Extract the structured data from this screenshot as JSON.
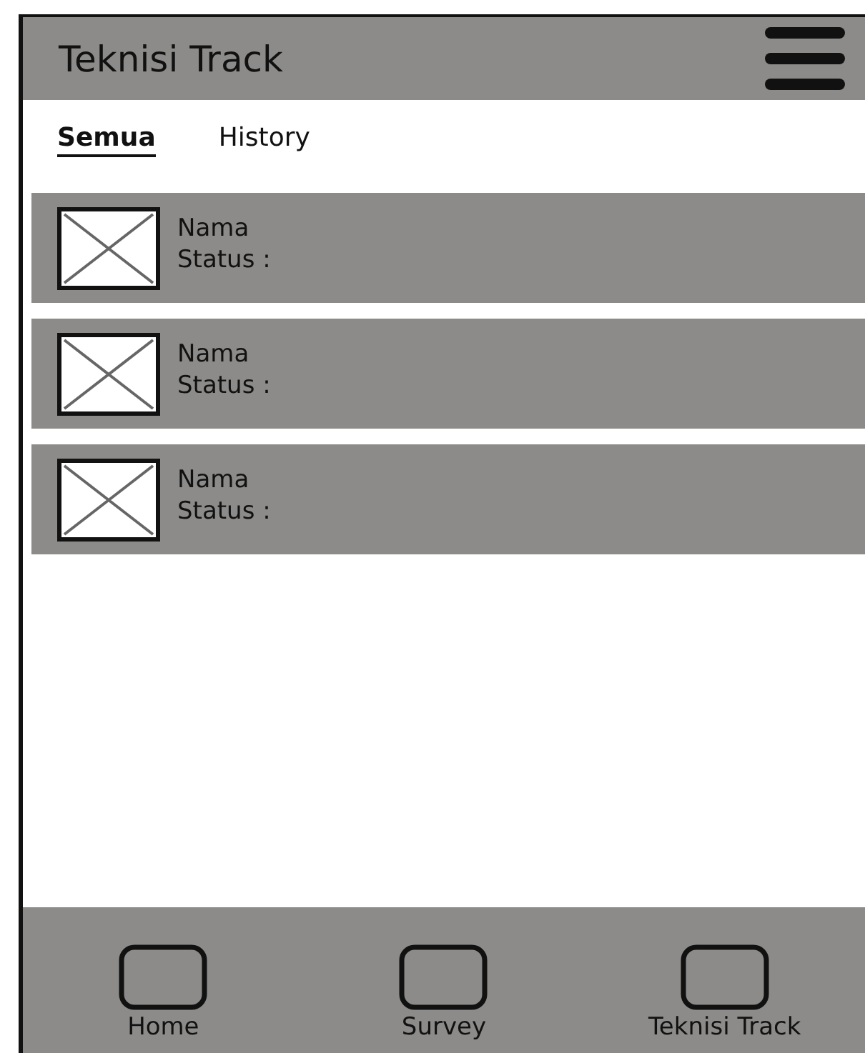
{
  "header": {
    "title": "Teknisi Track"
  },
  "tabs": [
    {
      "label": "Semua",
      "selected": true
    },
    {
      "label": "History",
      "selected": false
    }
  ],
  "items": [
    {
      "name": "Nama",
      "status": "Status :"
    },
    {
      "name": "Nama",
      "status": "Status :"
    },
    {
      "name": "Nama",
      "status": "Status :"
    }
  ],
  "nav": [
    {
      "label": "Home"
    },
    {
      "label": "Survey"
    },
    {
      "label": "Teknisi Track"
    }
  ]
}
